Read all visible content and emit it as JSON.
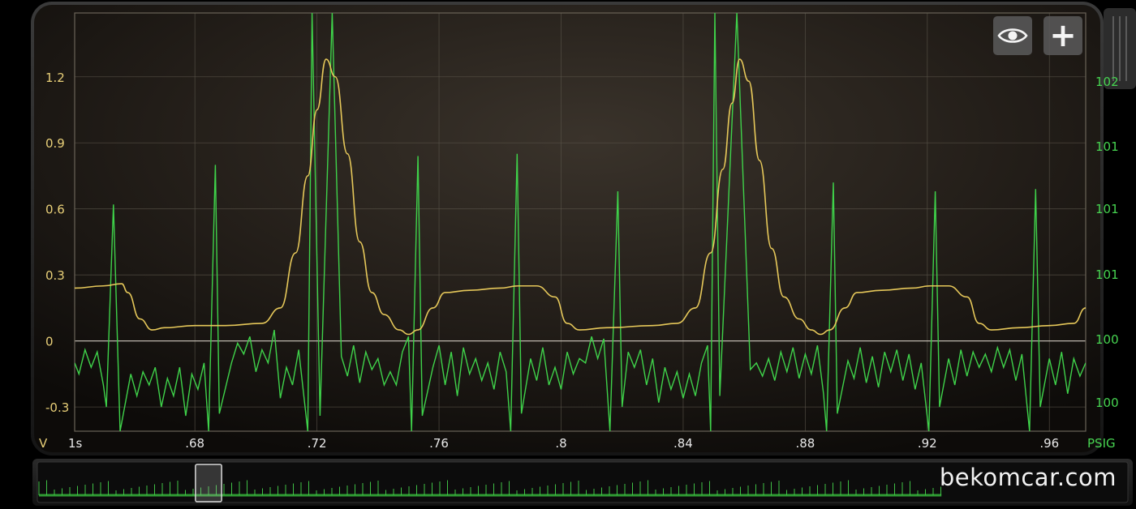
{
  "toolbar": {
    "eye_icon": "eye-icon",
    "add_icon": "plus-icon",
    "add_glyph": "+"
  },
  "watermark": "bekomcar.com",
  "colors": {
    "voltage": "#e6c85a",
    "psig": "#3fd24a",
    "left_axis_text": "#e8cf78",
    "right_axis_text": "#47d451",
    "grid": "#5a544a",
    "plot_bg_center": "#3a332b",
    "plot_bg_edge": "#0d0b09"
  },
  "chart_data": {
    "type": "line",
    "xlabel": "1s",
    "x_ticks": [
      0.68,
      0.72,
      0.76,
      0.8,
      0.84,
      0.88,
      0.92,
      0.96
    ],
    "x_tick_labels": [
      ".68",
      ".72",
      ".76",
      ".8",
      ".84",
      ".88",
      ".92",
      ".96"
    ],
    "xlim": [
      0.6406,
      0.9719
    ],
    "left_axis": {
      "label": "V",
      "ylim": [
        -0.41,
        1.49
      ],
      "ticks": [
        1.2,
        0.9,
        0.6,
        0.3,
        0,
        -0.3
      ],
      "tick_labels": [
        "1.2",
        "0.9",
        "0.6",
        "0.3",
        "0",
        "-0.3"
      ]
    },
    "right_axis": {
      "label": "PSIG",
      "tick_labels": [
        "102",
        "101",
        "101",
        "101",
        "100",
        "100"
      ]
    },
    "grid": true,
    "series": [
      {
        "name": "V",
        "axis": "left",
        "color": "#e6c85a",
        "points": [
          [
            0.6406,
            0.24
          ],
          [
            0.65,
            0.25
          ],
          [
            0.656,
            0.26
          ],
          [
            0.658,
            0.22
          ],
          [
            0.662,
            0.1
          ],
          [
            0.666,
            0.05
          ],
          [
            0.67,
            0.06
          ],
          [
            0.68,
            0.07
          ],
          [
            0.69,
            0.07
          ],
          [
            0.702,
            0.08
          ],
          [
            0.708,
            0.15
          ],
          [
            0.713,
            0.4
          ],
          [
            0.717,
            0.75
          ],
          [
            0.72,
            1.05
          ],
          [
            0.723,
            1.28
          ],
          [
            0.726,
            1.2
          ],
          [
            0.73,
            0.85
          ],
          [
            0.734,
            0.45
          ],
          [
            0.738,
            0.22
          ],
          [
            0.742,
            0.12
          ],
          [
            0.747,
            0.05
          ],
          [
            0.75,
            0.03
          ],
          [
            0.753,
            0.05
          ],
          [
            0.758,
            0.15
          ],
          [
            0.762,
            0.22
          ],
          [
            0.77,
            0.23
          ],
          [
            0.78,
            0.24
          ],
          [
            0.786,
            0.25
          ],
          [
            0.792,
            0.25
          ],
          [
            0.798,
            0.2
          ],
          [
            0.802,
            0.08
          ],
          [
            0.806,
            0.05
          ],
          [
            0.815,
            0.06
          ],
          [
            0.83,
            0.07
          ],
          [
            0.838,
            0.08
          ],
          [
            0.844,
            0.15
          ],
          [
            0.849,
            0.4
          ],
          [
            0.853,
            0.78
          ],
          [
            0.856,
            1.08
          ],
          [
            0.8585,
            1.28
          ],
          [
            0.8615,
            1.18
          ],
          [
            0.865,
            0.82
          ],
          [
            0.869,
            0.42
          ],
          [
            0.873,
            0.2
          ],
          [
            0.878,
            0.1
          ],
          [
            0.882,
            0.05
          ],
          [
            0.885,
            0.03
          ],
          [
            0.888,
            0.05
          ],
          [
            0.893,
            0.15
          ],
          [
            0.897,
            0.22
          ],
          [
            0.905,
            0.23
          ],
          [
            0.915,
            0.24
          ],
          [
            0.921,
            0.25
          ],
          [
            0.927,
            0.25
          ],
          [
            0.933,
            0.2
          ],
          [
            0.937,
            0.08
          ],
          [
            0.941,
            0.05
          ],
          [
            0.95,
            0.06
          ],
          [
            0.96,
            0.07
          ],
          [
            0.968,
            0.08
          ],
          [
            0.9719,
            0.15
          ]
        ]
      },
      {
        "name": "PSIG",
        "axis": "right",
        "color": "#3fd24a",
        "spikes_up": [
          [
            0.6533,
            0.62
          ],
          [
            0.6867,
            0.8
          ],
          [
            0.7184,
            1.49
          ],
          [
            0.725,
            1.49
          ],
          [
            0.7531,
            0.84
          ],
          [
            0.7856,
            0.85
          ],
          [
            0.8186,
            0.68
          ],
          [
            0.8504,
            1.49
          ],
          [
            0.8576,
            1.49
          ],
          [
            0.8892,
            0.72
          ],
          [
            0.9226,
            0.68
          ],
          [
            0.9555,
            0.69
          ]
        ],
        "spikes_down": [
          [
            0.651,
            -0.3
          ],
          [
            0.6555,
            -0.41
          ],
          [
            0.6845,
            -0.41
          ],
          [
            0.688,
            -0.33
          ],
          [
            0.717,
            -0.41
          ],
          [
            0.721,
            -0.34
          ],
          [
            0.751,
            -0.41
          ],
          [
            0.7545,
            -0.34
          ],
          [
            0.7835,
            -0.41
          ],
          [
            0.787,
            -0.33
          ],
          [
            0.816,
            -0.41
          ],
          [
            0.82,
            -0.3
          ],
          [
            0.849,
            -0.41
          ],
          [
            0.852,
            -0.25
          ],
          [
            0.887,
            -0.41
          ],
          [
            0.8905,
            -0.33
          ],
          [
            0.9205,
            -0.41
          ],
          [
            0.924,
            -0.3
          ],
          [
            0.9535,
            -0.41
          ],
          [
            0.957,
            -0.3
          ]
        ],
        "baseline_points": [
          [
            0.6406,
            -0.1
          ],
          [
            0.642,
            -0.15
          ],
          [
            0.644,
            -0.04
          ],
          [
            0.646,
            -0.12
          ],
          [
            0.648,
            -0.05
          ],
          [
            0.65,
            -0.2
          ],
          [
            0.659,
            -0.15
          ],
          [
            0.661,
            -0.25
          ],
          [
            0.663,
            -0.14
          ],
          [
            0.665,
            -0.2
          ],
          [
            0.667,
            -0.12
          ],
          [
            0.669,
            -0.3
          ],
          [
            0.671,
            -0.17
          ],
          [
            0.673,
            -0.25
          ],
          [
            0.675,
            -0.12
          ],
          [
            0.677,
            -0.34
          ],
          [
            0.679,
            -0.15
          ],
          [
            0.681,
            -0.22
          ],
          [
            0.683,
            -0.1
          ],
          [
            0.692,
            -0.1
          ],
          [
            0.694,
            -0.01
          ],
          [
            0.696,
            -0.06
          ],
          [
            0.698,
            0.02
          ],
          [
            0.7,
            -0.14
          ],
          [
            0.702,
            -0.04
          ],
          [
            0.704,
            -0.1
          ],
          [
            0.706,
            0.05
          ],
          [
            0.708,
            -0.26
          ],
          [
            0.71,
            -0.12
          ],
          [
            0.712,
            -0.2
          ],
          [
            0.714,
            -0.04
          ],
          [
            0.728,
            -0.07
          ],
          [
            0.73,
            -0.16
          ],
          [
            0.732,
            -0.02
          ],
          [
            0.734,
            -0.19
          ],
          [
            0.736,
            -0.05
          ],
          [
            0.738,
            -0.13
          ],
          [
            0.74,
            -0.08
          ],
          [
            0.742,
            -0.2
          ],
          [
            0.744,
            -0.14
          ],
          [
            0.746,
            -0.2
          ],
          [
            0.748,
            -0.05
          ],
          [
            0.75,
            0.02
          ],
          [
            0.758,
            -0.12
          ],
          [
            0.76,
            -0.02
          ],
          [
            0.762,
            -0.2
          ],
          [
            0.764,
            -0.05
          ],
          [
            0.766,
            -0.25
          ],
          [
            0.768,
            -0.03
          ],
          [
            0.77,
            -0.15
          ],
          [
            0.772,
            -0.08
          ],
          [
            0.774,
            -0.18
          ],
          [
            0.776,
            -0.1
          ],
          [
            0.778,
            -0.22
          ],
          [
            0.78,
            -0.05
          ],
          [
            0.782,
            -0.14
          ],
          [
            0.79,
            -0.08
          ],
          [
            0.792,
            -0.18
          ],
          [
            0.794,
            -0.03
          ],
          [
            0.796,
            -0.2
          ],
          [
            0.798,
            -0.12
          ],
          [
            0.8,
            -0.22
          ],
          [
            0.802,
            -0.05
          ],
          [
            0.804,
            -0.15
          ],
          [
            0.806,
            -0.08
          ],
          [
            0.808,
            -0.1
          ],
          [
            0.81,
            0.02
          ],
          [
            0.812,
            -0.08
          ],
          [
            0.814,
            0.01
          ],
          [
            0.822,
            -0.05
          ],
          [
            0.824,
            -0.12
          ],
          [
            0.826,
            -0.04
          ],
          [
            0.828,
            -0.2
          ],
          [
            0.83,
            -0.08
          ],
          [
            0.832,
            -0.28
          ],
          [
            0.834,
            -0.12
          ],
          [
            0.836,
            -0.22
          ],
          [
            0.838,
            -0.14
          ],
          [
            0.84,
            -0.26
          ],
          [
            0.842,
            -0.15
          ],
          [
            0.844,
            -0.25
          ],
          [
            0.846,
            -0.1
          ],
          [
            0.848,
            -0.02
          ],
          [
            0.862,
            -0.13
          ],
          [
            0.864,
            -0.1
          ],
          [
            0.866,
            -0.16
          ],
          [
            0.868,
            -0.08
          ],
          [
            0.87,
            -0.18
          ],
          [
            0.872,
            -0.05
          ],
          [
            0.874,
            -0.14
          ],
          [
            0.876,
            -0.03
          ],
          [
            0.878,
            -0.17
          ],
          [
            0.88,
            -0.06
          ],
          [
            0.882,
            -0.15
          ],
          [
            0.884,
            -0.02
          ],
          [
            0.886,
            -0.24
          ],
          [
            0.894,
            -0.09
          ],
          [
            0.896,
            -0.17
          ],
          [
            0.898,
            -0.03
          ],
          [
            0.9,
            -0.19
          ],
          [
            0.902,
            -0.07
          ],
          [
            0.904,
            -0.21
          ],
          [
            0.906,
            -0.05
          ],
          [
            0.908,
            -0.14
          ],
          [
            0.91,
            -0.04
          ],
          [
            0.912,
            -0.18
          ],
          [
            0.914,
            -0.06
          ],
          [
            0.916,
            -0.22
          ],
          [
            0.918,
            -0.1
          ],
          [
            0.927,
            -0.08
          ],
          [
            0.929,
            -0.2
          ],
          [
            0.931,
            -0.04
          ],
          [
            0.933,
            -0.16
          ],
          [
            0.935,
            -0.05
          ],
          [
            0.937,
            -0.12
          ],
          [
            0.939,
            -0.06
          ],
          [
            0.941,
            -0.14
          ],
          [
            0.943,
            -0.03
          ],
          [
            0.945,
            -0.12
          ],
          [
            0.947,
            -0.04
          ],
          [
            0.949,
            -0.18
          ],
          [
            0.951,
            -0.06
          ],
          [
            0.96,
            -0.08
          ],
          [
            0.962,
            -0.2
          ],
          [
            0.964,
            -0.05
          ],
          [
            0.966,
            -0.24
          ],
          [
            0.968,
            -0.08
          ],
          [
            0.97,
            -0.16
          ],
          [
            0.9719,
            -0.1
          ]
        ]
      }
    ],
    "overview": {
      "window_start_fraction": 0.145,
      "window_end_fraction": 0.169,
      "trace_end_fraction": 0.83
    }
  }
}
